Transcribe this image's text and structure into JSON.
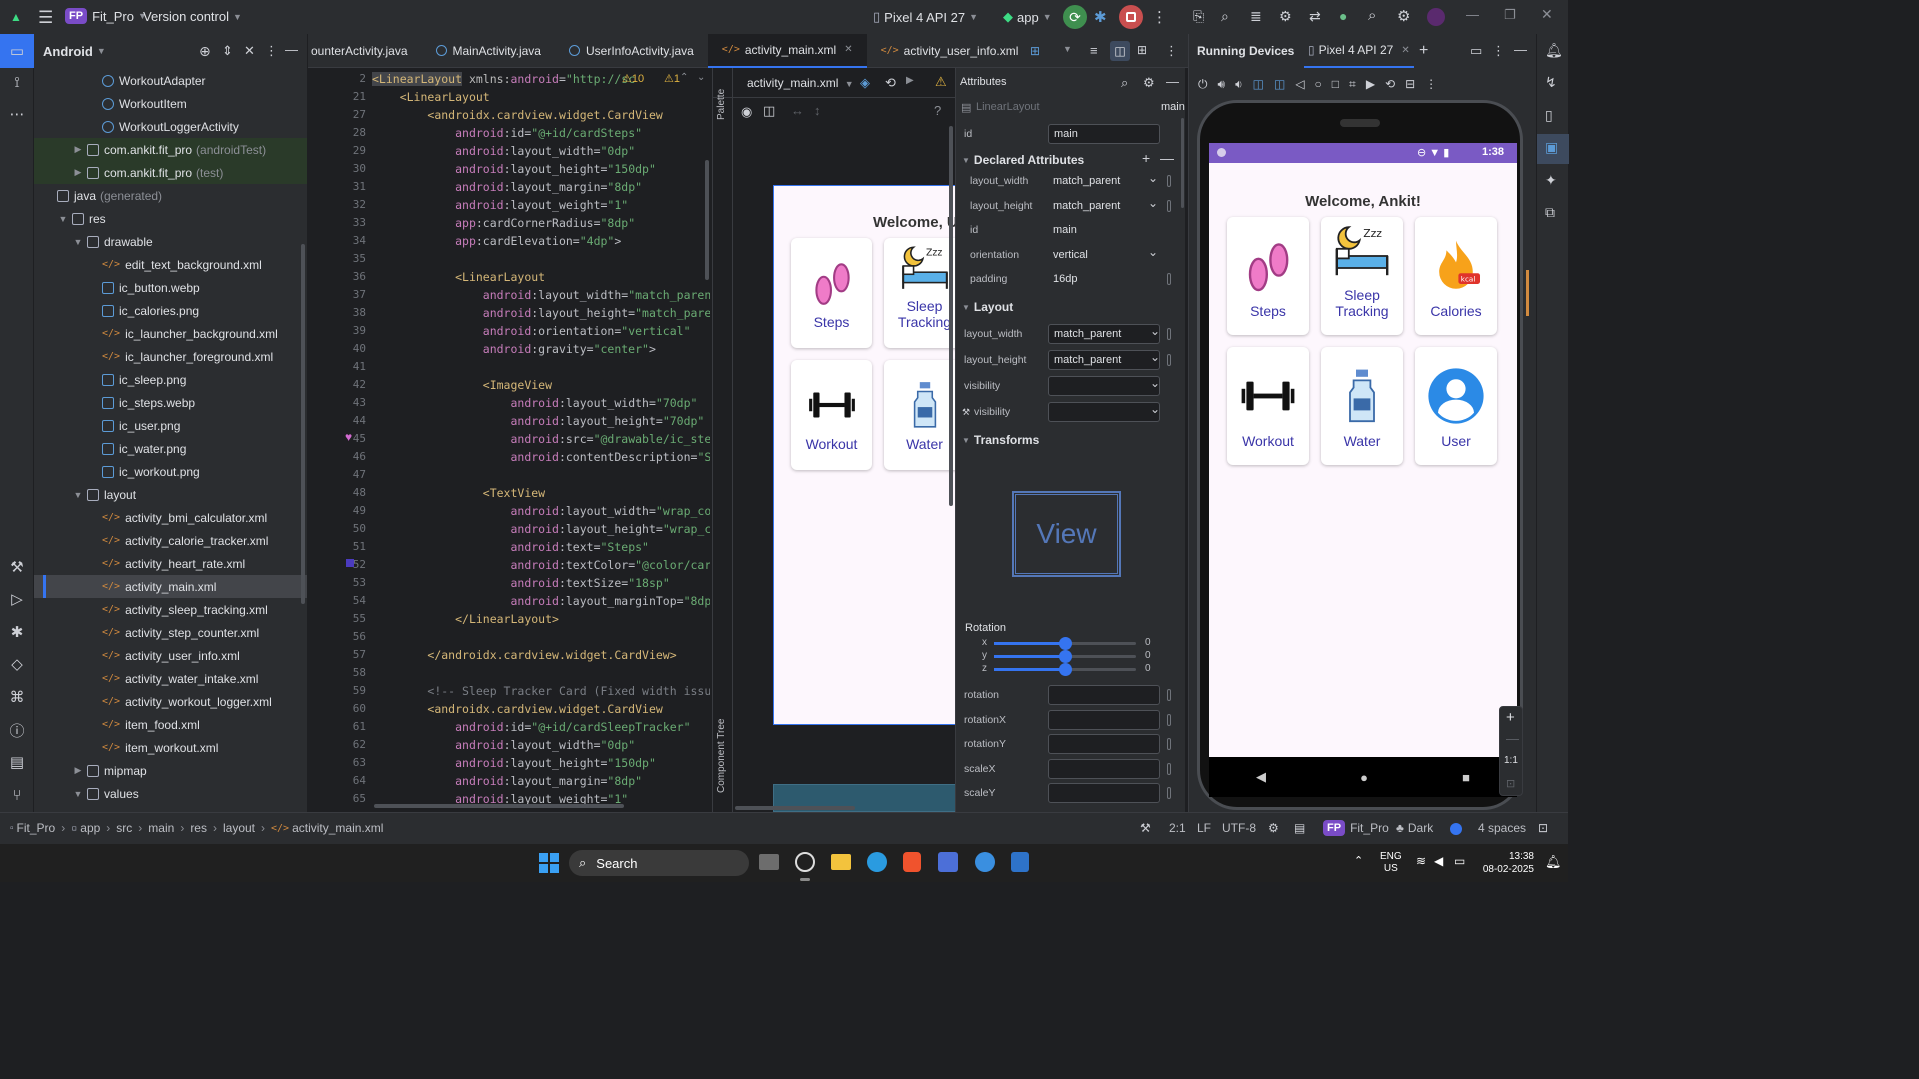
{
  "titlebar": {
    "project_badge": "FP",
    "project_name": "Fit_Pro",
    "vcs": "Version control",
    "device": "Pixel 4 API 27",
    "run_config": "app"
  },
  "project_panel": {
    "view": "Android",
    "tree": [
      {
        "label": "WorkoutAdapter",
        "type": "cls",
        "indent": 4
      },
      {
        "label": "WorkoutItem",
        "type": "cls",
        "indent": 4
      },
      {
        "label": "WorkoutLoggerActivity",
        "type": "cls",
        "indent": 4
      },
      {
        "label": "com.ankit.fit_pro",
        "suffix": "(androidTest)",
        "type": "fld",
        "indent": 2,
        "arrow": "▶",
        "green": true
      },
      {
        "label": "com.ankit.fit_pro",
        "suffix": "(test)",
        "type": "fld",
        "indent": 2,
        "arrow": "▶",
        "green": true
      },
      {
        "label": "java",
        "suffix": "(generated)",
        "type": "fld",
        "indent": 1
      },
      {
        "label": "res",
        "type": "fld",
        "indent": 1,
        "arrow": "▼"
      },
      {
        "label": "drawable",
        "type": "fld",
        "indent": 2,
        "arrow": "▼"
      },
      {
        "label": "edit_text_background.xml",
        "type": "xml",
        "indent": 4
      },
      {
        "label": "ic_button.webp",
        "type": "img",
        "indent": 4
      },
      {
        "label": "ic_calories.png",
        "type": "img",
        "indent": 4
      },
      {
        "label": "ic_launcher_background.xml",
        "type": "xml",
        "indent": 4
      },
      {
        "label": "ic_launcher_foreground.xml",
        "type": "xml",
        "indent": 4
      },
      {
        "label": "ic_sleep.png",
        "type": "img",
        "indent": 4
      },
      {
        "label": "ic_steps.webp",
        "type": "img",
        "indent": 4
      },
      {
        "label": "ic_user.png",
        "type": "img",
        "indent": 4
      },
      {
        "label": "ic_water.png",
        "type": "img",
        "indent": 4
      },
      {
        "label": "ic_workout.png",
        "type": "img",
        "indent": 4
      },
      {
        "label": "layout",
        "type": "fld",
        "indent": 2,
        "arrow": "▼"
      },
      {
        "label": "activity_bmi_calculator.xml",
        "type": "xml",
        "indent": 4
      },
      {
        "label": "activity_calorie_tracker.xml",
        "type": "xml",
        "indent": 4
      },
      {
        "label": "activity_heart_rate.xml",
        "type": "xml",
        "indent": 4
      },
      {
        "label": "activity_main.xml",
        "type": "xml",
        "indent": 4,
        "selected": true
      },
      {
        "label": "activity_sleep_tracking.xml",
        "type": "xml",
        "indent": 4
      },
      {
        "label": "activity_step_counter.xml",
        "type": "xml",
        "indent": 4
      },
      {
        "label": "activity_user_info.xml",
        "type": "xml",
        "indent": 4
      },
      {
        "label": "activity_water_intake.xml",
        "type": "xml",
        "indent": 4
      },
      {
        "label": "activity_workout_logger.xml",
        "type": "xml",
        "indent": 4
      },
      {
        "label": "item_food.xml",
        "type": "xml",
        "indent": 4
      },
      {
        "label": "item_workout.xml",
        "type": "xml",
        "indent": 4
      },
      {
        "label": "mipmap",
        "type": "fld",
        "indent": 2,
        "arrow": "▶"
      },
      {
        "label": "values",
        "type": "fld",
        "indent": 2,
        "arrow": "▼"
      }
    ]
  },
  "tabs": [
    {
      "label": "ounterActivity.java"
    },
    {
      "label": "MainActivity.java"
    },
    {
      "label": "UserInfoActivity.java"
    },
    {
      "label": "activity_main.xml",
      "active": true
    },
    {
      "label": "activity_user_info.xml"
    }
  ],
  "editor": {
    "warnings": "⚠10",
    "lines": [
      {
        "n": "2",
        "html": "<span class='tag'>&lt;LinearLayout</span> <span class='attr'>xmlns:</span><span class='ns'>android</span>=<span class='str'>\"http://sc</span>"
      },
      {
        "n": "21",
        "html": "    <span class='tag'>&lt;LinearLayout</span>"
      },
      {
        "n": "27",
        "html": "        <span class='tag'>&lt;androidx.cardview.widget.CardView</span>"
      },
      {
        "n": "28",
        "html": "            <span class='ns'>android</span>:id=<span class='str'>\"@+id/cardSteps\"</span>"
      },
      {
        "n": "29",
        "html": "            <span class='ns'>android</span>:layout_width=<span class='str'>\"0dp\"</span>"
      },
      {
        "n": "30",
        "html": "            <span class='ns'>android</span>:layout_height=<span class='str'>\"150dp\"</span>"
      },
      {
        "n": "31",
        "html": "            <span class='ns'>android</span>:layout_margin=<span class='str'>\"8dp\"</span>"
      },
      {
        "n": "32",
        "html": "            <span class='ns'>android</span>:layout_weight=<span class='str'>\"1\"</span>"
      },
      {
        "n": "33",
        "html": "            <span class='ns'>app</span>:cardCornerRadius=<span class='str'>\"8dp\"</span>"
      },
      {
        "n": "34",
        "html": "            <span class='ns'>app</span>:cardElevation=<span class='str'>\"4dp\"</span>&gt;"
      },
      {
        "n": "35",
        "html": ""
      },
      {
        "n": "36",
        "html": "            <span class='tag'>&lt;LinearLayout</span>"
      },
      {
        "n": "37",
        "html": "                <span class='ns'>android</span>:layout_width=<span class='str'>\"match_parent\"</span>"
      },
      {
        "n": "38",
        "html": "                <span class='ns'>android</span>:layout_height=<span class='str'>\"match_parent\"</span>"
      },
      {
        "n": "39",
        "html": "                <span class='ns'>android</span>:orientation=<span class='str'>\"vertical\"</span>"
      },
      {
        "n": "40",
        "html": "                <span class='ns'>android</span>:gravity=<span class='str'>\"center\"</span>&gt;"
      },
      {
        "n": "41",
        "html": ""
      },
      {
        "n": "42",
        "html": "                <span class='tag'>&lt;ImageView</span>"
      },
      {
        "n": "43",
        "html": "                    <span class='ns'>android</span>:layout_width=<span class='str'>\"70dp\"</span>"
      },
      {
        "n": "44",
        "html": "                    <span class='ns'>android</span>:layout_height=<span class='str'>\"70dp\"</span>"
      },
      {
        "n": "45",
        "html": "                    <span class='ns'>android</span>:src=<span class='str'>\"@drawable/ic_steps\"</span>"
      },
      {
        "n": "46",
        "html": "                    <span class='ns'>android</span>:contentDescription=<span class='str'>\"Step</span>"
      },
      {
        "n": "47",
        "html": ""
      },
      {
        "n": "48",
        "html": "                <span class='tag'>&lt;TextView</span>"
      },
      {
        "n": "49",
        "html": "                    <span class='ns'>android</span>:layout_width=<span class='str'>\"wrap_conte</span>"
      },
      {
        "n": "50",
        "html": "                    <span class='ns'>android</span>:layout_height=<span class='str'>\"wrap_cont</span>"
      },
      {
        "n": "51",
        "html": "                    <span class='ns'>android</span>:text=<span class='str'>\"Steps\"</span>"
      },
      {
        "n": "52",
        "html": "                    <span class='ns'>android</span>:textColor=<span class='str'>\"@color/card_t</span>"
      },
      {
        "n": "53",
        "html": "                    <span class='ns'>android</span>:textSize=<span class='str'>\"18sp\"</span>"
      },
      {
        "n": "54",
        "html": "                    <span class='ns'>android</span>:layout_marginTop=<span class='str'>\"8dp\"</span>/&gt;"
      },
      {
        "n": "55",
        "html": "            <span class='tag'>&lt;/LinearLayout&gt;</span>"
      },
      {
        "n": "56",
        "html": ""
      },
      {
        "n": "57",
        "html": "        <span class='tag'>&lt;/androidx.cardview.widget.CardView&gt;</span>"
      },
      {
        "n": "58",
        "html": ""
      },
      {
        "n": "59",
        "html": "        <span class='cmt'>&lt;!-- Sleep Tracker Card (Fixed width issue)</span>"
      },
      {
        "n": "60",
        "html": "        <span class='tag'>&lt;androidx.cardview.widget.CardView</span>"
      },
      {
        "n": "61",
        "html": "            <span class='ns'>android</span>:id=<span class='str'>\"@+id/cardSleepTracker\"</span>"
      },
      {
        "n": "62",
        "html": "            <span class='ns'>android</span>:layout_width=<span class='str'>\"0dp\"</span>"
      },
      {
        "n": "63",
        "html": "            <span class='ns'>android</span>:layout_height=<span class='str'>\"150dp\"</span>"
      },
      {
        "n": "64",
        "html": "            <span class='ns'>android</span>:layout_margin=<span class='str'>\"8dp\"</span>"
      },
      {
        "n": "65",
        "html": "            <span class='ns'>android</span>:layout_weight=<span class='str'>\"1\"</span>"
      }
    ]
  },
  "design": {
    "file": "activity_main.xml",
    "palette": "Palette",
    "component_tree": "Component Tree",
    "preview_title": "Welcome, Us",
    "cards": [
      "Steps",
      "Sleep Tracking",
      "Workout",
      "Water"
    ]
  },
  "attributes": {
    "title": "Attributes",
    "component": "LinearLayout",
    "component_id": "main",
    "id_label": "id",
    "id_value": "main",
    "declared_title": "Declared Attributes",
    "declared": [
      {
        "label": "layout_width",
        "value": "match_parent"
      },
      {
        "label": "layout_height",
        "value": "match_parent"
      },
      {
        "label": "id",
        "value": "main"
      },
      {
        "label": "orientation",
        "value": "vertical"
      },
      {
        "label": "padding",
        "value": "16dp"
      }
    ],
    "layout_title": "Layout",
    "layout": [
      {
        "label": "layout_width",
        "value": "match_parent"
      },
      {
        "label": "layout_height",
        "value": "match_parent"
      },
      {
        "label": "visibility",
        "value": ""
      },
      {
        "label": "visibility",
        "value": ""
      }
    ],
    "transforms_title": "Transforms",
    "view_preview": "View",
    "rotation_title": "Rotation",
    "rotation_axes": [
      {
        "axis": "x",
        "value": "0"
      },
      {
        "axis": "y",
        "value": "0"
      },
      {
        "axis": "z",
        "value": "0"
      }
    ],
    "transform_fields": [
      "rotation",
      "rotationX",
      "rotationY",
      "scaleX",
      "scaleY"
    ]
  },
  "running_devices": {
    "title": "Running Devices",
    "device_tab": "Pixel 4 API 27",
    "time": "1:38",
    "welcome": "Welcome, Ankit!",
    "cards": [
      "Steps",
      "Sleep Tracking",
      "Calories",
      "Workout",
      "Water",
      "User"
    ],
    "zoom": "1:1"
  },
  "statusbar": {
    "breadcrumb": [
      "Fit_Pro",
      "app",
      "src",
      "main",
      "res",
      "layout",
      "activity_main.xml"
    ],
    "position": "2:1",
    "line_sep": "LF",
    "encoding": "UTF-8",
    "project": "Fit_Pro",
    "theme": "Dark",
    "indent": "4 spaces"
  },
  "taskbar": {
    "search": "Search",
    "lang": "ENG",
    "region": "US",
    "time": "13:38",
    "date": "08-02-2025"
  },
  "colors": {
    "accent": "#3574f0",
    "card_text": "#3a35a8",
    "phone_bg": "#fdf7fd",
    "status_purple": "#7a5ac4"
  }
}
